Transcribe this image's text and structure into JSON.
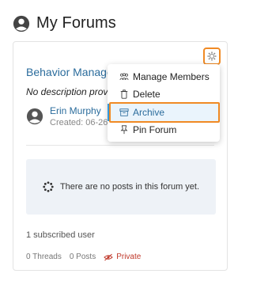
{
  "header": {
    "title": "My Forums"
  },
  "forum": {
    "title": "Behavior Manage",
    "description": "No description provi",
    "author": {
      "name": "Erin Murphy",
      "created_label": "Created: 06-26"
    },
    "empty_message": "There are no posts in this forum yet.",
    "subscribed": "1 subscribed user",
    "stats": {
      "threads": "0 Threads",
      "posts": "0 Posts",
      "privacy": "Private"
    }
  },
  "menu": {
    "items": [
      {
        "label": "Manage Members",
        "icon": "users-icon"
      },
      {
        "label": "Delete",
        "icon": "trash-icon"
      },
      {
        "label": "Archive",
        "icon": "archive-icon",
        "selected": true
      },
      {
        "label": "Pin Forum",
        "icon": "pin-icon"
      }
    ]
  },
  "colors": {
    "accent": "#f08a24",
    "link": "#2b6c9c",
    "private": "#c0392b",
    "empty_bg": "#eef2f7"
  }
}
